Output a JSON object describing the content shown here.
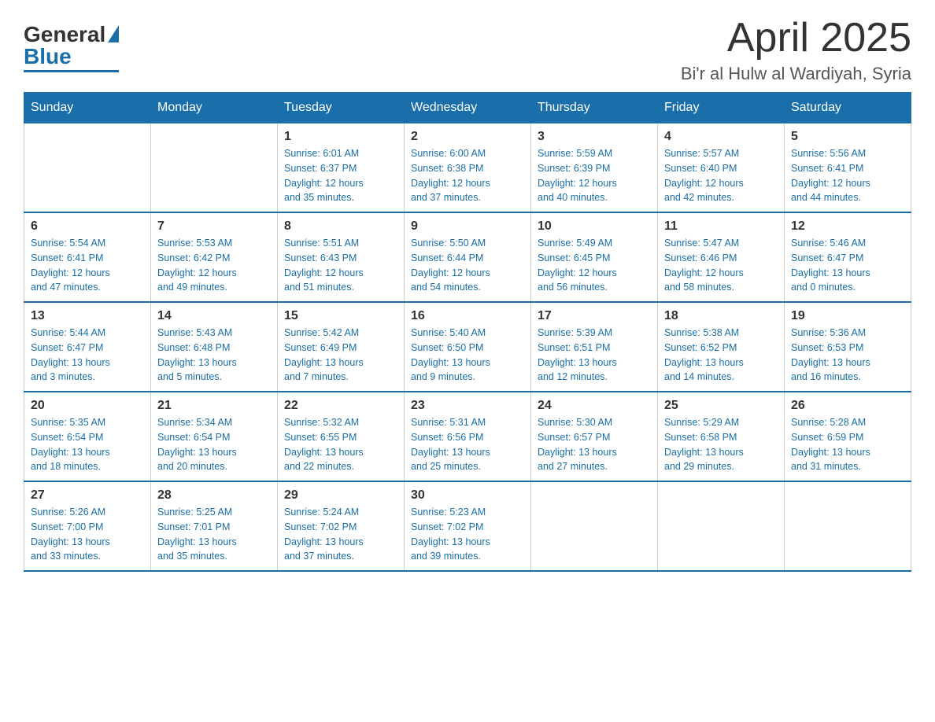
{
  "logo": {
    "general": "General",
    "blue": "Blue"
  },
  "title": "April 2025",
  "location": "Bi'r al Hulw al Wardiyah, Syria",
  "headers": [
    "Sunday",
    "Monday",
    "Tuesday",
    "Wednesday",
    "Thursday",
    "Friday",
    "Saturday"
  ],
  "weeks": [
    [
      {
        "day": "",
        "info": ""
      },
      {
        "day": "",
        "info": ""
      },
      {
        "day": "1",
        "info": "Sunrise: 6:01 AM\nSunset: 6:37 PM\nDaylight: 12 hours\nand 35 minutes."
      },
      {
        "day": "2",
        "info": "Sunrise: 6:00 AM\nSunset: 6:38 PM\nDaylight: 12 hours\nand 37 minutes."
      },
      {
        "day": "3",
        "info": "Sunrise: 5:59 AM\nSunset: 6:39 PM\nDaylight: 12 hours\nand 40 minutes."
      },
      {
        "day": "4",
        "info": "Sunrise: 5:57 AM\nSunset: 6:40 PM\nDaylight: 12 hours\nand 42 minutes."
      },
      {
        "day": "5",
        "info": "Sunrise: 5:56 AM\nSunset: 6:41 PM\nDaylight: 12 hours\nand 44 minutes."
      }
    ],
    [
      {
        "day": "6",
        "info": "Sunrise: 5:54 AM\nSunset: 6:41 PM\nDaylight: 12 hours\nand 47 minutes."
      },
      {
        "day": "7",
        "info": "Sunrise: 5:53 AM\nSunset: 6:42 PM\nDaylight: 12 hours\nand 49 minutes."
      },
      {
        "day": "8",
        "info": "Sunrise: 5:51 AM\nSunset: 6:43 PM\nDaylight: 12 hours\nand 51 minutes."
      },
      {
        "day": "9",
        "info": "Sunrise: 5:50 AM\nSunset: 6:44 PM\nDaylight: 12 hours\nand 54 minutes."
      },
      {
        "day": "10",
        "info": "Sunrise: 5:49 AM\nSunset: 6:45 PM\nDaylight: 12 hours\nand 56 minutes."
      },
      {
        "day": "11",
        "info": "Sunrise: 5:47 AM\nSunset: 6:46 PM\nDaylight: 12 hours\nand 58 minutes."
      },
      {
        "day": "12",
        "info": "Sunrise: 5:46 AM\nSunset: 6:47 PM\nDaylight: 13 hours\nand 0 minutes."
      }
    ],
    [
      {
        "day": "13",
        "info": "Sunrise: 5:44 AM\nSunset: 6:47 PM\nDaylight: 13 hours\nand 3 minutes."
      },
      {
        "day": "14",
        "info": "Sunrise: 5:43 AM\nSunset: 6:48 PM\nDaylight: 13 hours\nand 5 minutes."
      },
      {
        "day": "15",
        "info": "Sunrise: 5:42 AM\nSunset: 6:49 PM\nDaylight: 13 hours\nand 7 minutes."
      },
      {
        "day": "16",
        "info": "Sunrise: 5:40 AM\nSunset: 6:50 PM\nDaylight: 13 hours\nand 9 minutes."
      },
      {
        "day": "17",
        "info": "Sunrise: 5:39 AM\nSunset: 6:51 PM\nDaylight: 13 hours\nand 12 minutes."
      },
      {
        "day": "18",
        "info": "Sunrise: 5:38 AM\nSunset: 6:52 PM\nDaylight: 13 hours\nand 14 minutes."
      },
      {
        "day": "19",
        "info": "Sunrise: 5:36 AM\nSunset: 6:53 PM\nDaylight: 13 hours\nand 16 minutes."
      }
    ],
    [
      {
        "day": "20",
        "info": "Sunrise: 5:35 AM\nSunset: 6:54 PM\nDaylight: 13 hours\nand 18 minutes."
      },
      {
        "day": "21",
        "info": "Sunrise: 5:34 AM\nSunset: 6:54 PM\nDaylight: 13 hours\nand 20 minutes."
      },
      {
        "day": "22",
        "info": "Sunrise: 5:32 AM\nSunset: 6:55 PM\nDaylight: 13 hours\nand 22 minutes."
      },
      {
        "day": "23",
        "info": "Sunrise: 5:31 AM\nSunset: 6:56 PM\nDaylight: 13 hours\nand 25 minutes."
      },
      {
        "day": "24",
        "info": "Sunrise: 5:30 AM\nSunset: 6:57 PM\nDaylight: 13 hours\nand 27 minutes."
      },
      {
        "day": "25",
        "info": "Sunrise: 5:29 AM\nSunset: 6:58 PM\nDaylight: 13 hours\nand 29 minutes."
      },
      {
        "day": "26",
        "info": "Sunrise: 5:28 AM\nSunset: 6:59 PM\nDaylight: 13 hours\nand 31 minutes."
      }
    ],
    [
      {
        "day": "27",
        "info": "Sunrise: 5:26 AM\nSunset: 7:00 PM\nDaylight: 13 hours\nand 33 minutes."
      },
      {
        "day": "28",
        "info": "Sunrise: 5:25 AM\nSunset: 7:01 PM\nDaylight: 13 hours\nand 35 minutes."
      },
      {
        "day": "29",
        "info": "Sunrise: 5:24 AM\nSunset: 7:02 PM\nDaylight: 13 hours\nand 37 minutes."
      },
      {
        "day": "30",
        "info": "Sunrise: 5:23 AM\nSunset: 7:02 PM\nDaylight: 13 hours\nand 39 minutes."
      },
      {
        "day": "",
        "info": ""
      },
      {
        "day": "",
        "info": ""
      },
      {
        "day": "",
        "info": ""
      }
    ]
  ]
}
